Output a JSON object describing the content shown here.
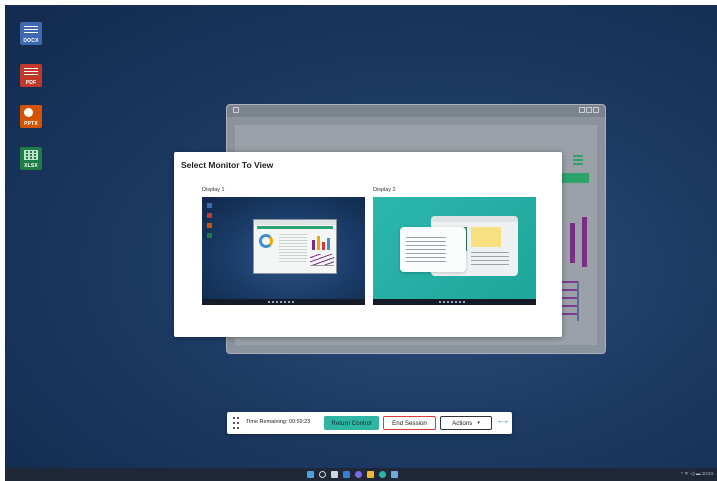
{
  "desktop": {
    "icons": [
      {
        "name": "docx-icon",
        "tag": "DOCX",
        "color": "#3d6ab0"
      },
      {
        "name": "pdf-icon",
        "tag": "PDF",
        "color": "#c0392b"
      },
      {
        "name": "pptx-icon",
        "tag": "PPTX",
        "color": "#d35400"
      },
      {
        "name": "xlsx-icon",
        "tag": "XLSX",
        "color": "#1e7d45"
      }
    ]
  },
  "dialog": {
    "title": "Select Monitor To View",
    "displays": [
      {
        "label": "Display 1"
      },
      {
        "label": "Display 2"
      }
    ]
  },
  "toolbar": {
    "timer": "Time Remaining: 00:59:23",
    "return_label": "Return Control",
    "end_label": "End Session",
    "actions_label": "Actions",
    "actions_caret": "▾",
    "expand_glyph": "⟷"
  },
  "taskbar": {
    "icons": [
      "start-icon",
      "search-icon",
      "task-view-icon",
      "widgets-icon",
      "teams-icon",
      "file-explorer-icon",
      "edge-icon",
      "store-icon"
    ],
    "tray": "^ ᯤ ◁) ▬  10:24"
  },
  "colors": {
    "accent": "#2fb5a3",
    "danger": "#d9383a",
    "desktop": "#1d3a63"
  }
}
